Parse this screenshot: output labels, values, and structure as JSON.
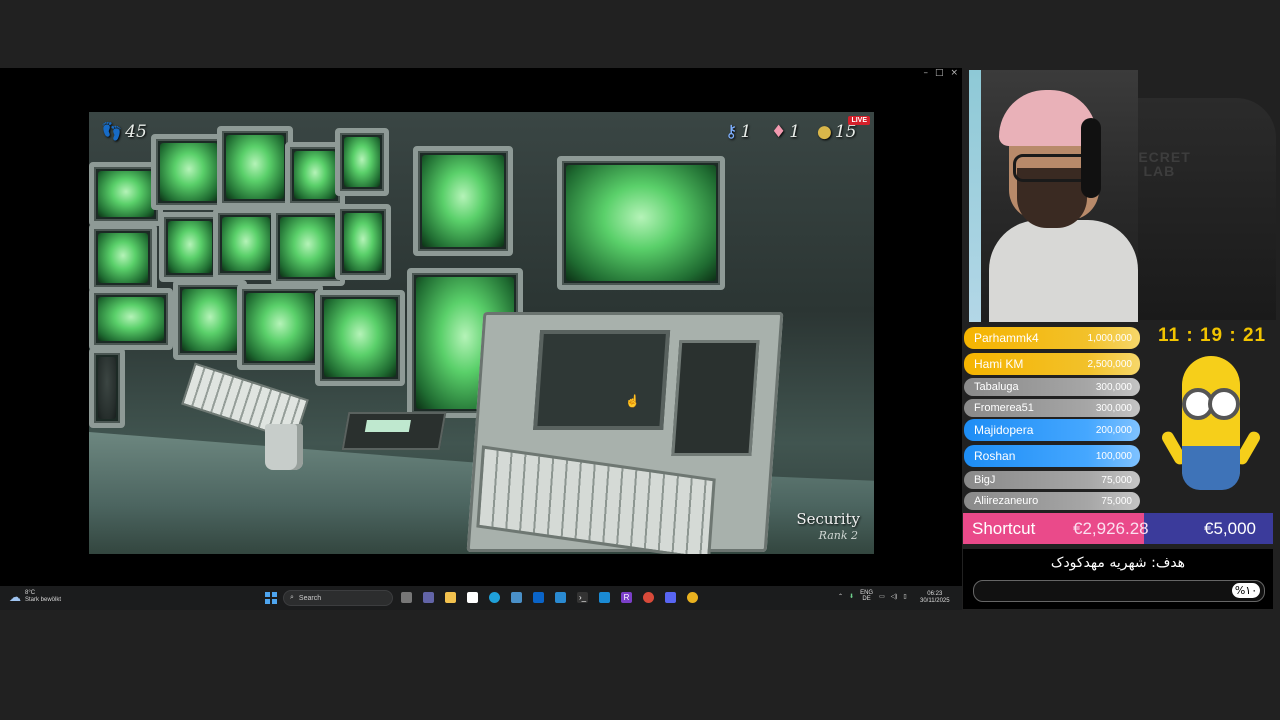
{
  "window": {
    "controls": [
      "–",
      "□",
      "×"
    ]
  },
  "game": {
    "hud": {
      "lives": "45",
      "keys": "1",
      "gems": "1",
      "coins": "15"
    },
    "live_badge": "LIVE",
    "location_title": "Security",
    "location_rank": "Rank 2"
  },
  "taskbar": {
    "weather_temp": "8°C",
    "weather_desc": "Stark bewölkt",
    "search_placeholder": "Search",
    "lang_line1": "ENG",
    "lang_line2": "DE",
    "time": "06:23",
    "date": "30/11/2025"
  },
  "overlay": {
    "webcam_brand_line1": "SECRET",
    "webcam_brand_line2": "LAB",
    "timer": "11 : 19 : 21",
    "leaderboard": [
      {
        "name": "Parhammk4",
        "amount": "1,000,000",
        "tier": "gold"
      },
      {
        "name": "Hami KM",
        "amount": "2,500,000",
        "tier": "gold"
      },
      {
        "name": "Tabaluga",
        "amount": "300,000",
        "tier": "grey"
      },
      {
        "name": "Fromerea51",
        "amount": "300,000",
        "tier": "grey"
      },
      {
        "name": "Majidopera",
        "amount": "200,000",
        "tier": "blue"
      },
      {
        "name": "Roshan",
        "amount": "100,000",
        "tier": "blue"
      },
      {
        "name": "BigJ",
        "amount": "75,000",
        "tier": "grey"
      },
      {
        "name": "Aliirezaneuro",
        "amount": "75,000",
        "tier": "grey"
      }
    ],
    "goal": {
      "label": "Shortcut",
      "current": "€2,926.28",
      "target": "€5,000",
      "progress": 0.585
    },
    "target_goal": {
      "title": "هدف: شهریه مهدکودک",
      "percent": "%۱۰",
      "progress": 0.1
    }
  },
  "colors": {
    "gold": "#f5b400",
    "blue": "#1d8df5",
    "grey": "#a6a6a6",
    "pink": "#ea4a8a",
    "indigo": "#3b3b9b",
    "timer": "#f2c400"
  }
}
